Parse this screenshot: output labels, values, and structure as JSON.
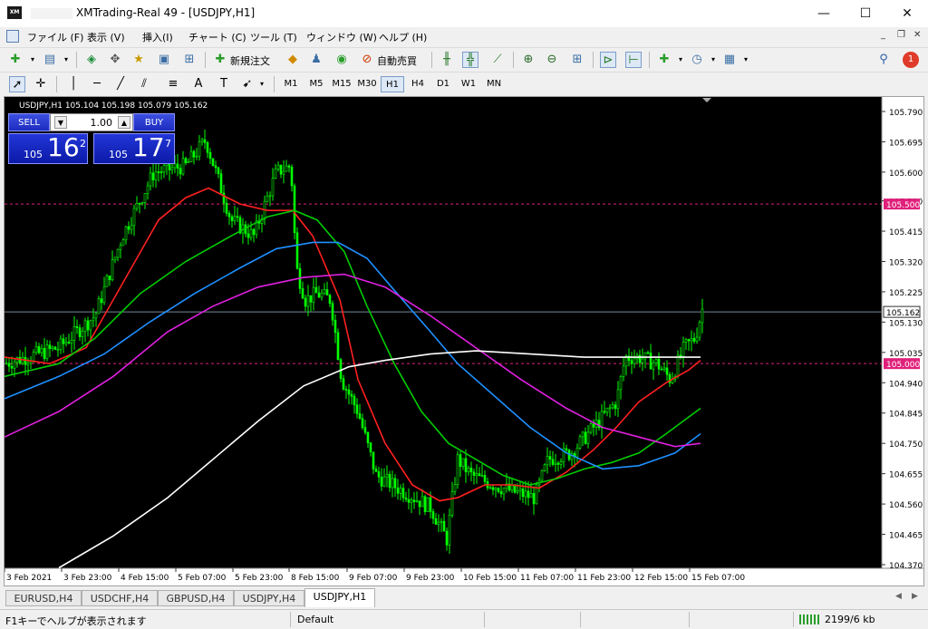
{
  "window": {
    "title": "XMTrading-Real 49 - [USDJPY,H1]",
    "logo": "XM",
    "min_icon": "—",
    "max_icon": "☐",
    "close_icon": "✕"
  },
  "menu": [
    {
      "label": "ファイル (F)"
    },
    {
      "label": "表示 (V)"
    },
    {
      "label": "挿入(I)"
    },
    {
      "label": "チャート (C)"
    },
    {
      "label": "ツール (T)"
    },
    {
      "label": "ウィンドウ (W)"
    },
    {
      "label": "ヘルプ (H)"
    }
  ],
  "toolbar": {
    "new_order_label": "新規注文",
    "auto_trade_label": "自動売買",
    "alerts_count": "1"
  },
  "timeframes": [
    "M1",
    "M5",
    "M15",
    "M30",
    "H1",
    "H4",
    "D1",
    "W1",
    "MN"
  ],
  "active_timeframe": "H1",
  "chart": {
    "header": "USDJPY,H1  105.104 105.198 105.079 105.162",
    "current_price_label": "105.162",
    "hline_upper_label": "105.500",
    "hline_lower_label": "105.000",
    "colors": {
      "background": "#000000",
      "candles": "#00ff00",
      "ma_fast": "#ff2020",
      "ma_green": "#00cc00",
      "ma_blue": "#1e90ff",
      "ma_magenta": "#e020e0",
      "ma_slow": "#ffffff",
      "hline": "#e0207a",
      "bid_line": "#778899"
    },
    "price_ticks": [
      "105.790",
      "105.695",
      "105.600",
      "105.510",
      "105.415",
      "105.320",
      "105.225",
      "105.130",
      "105.035",
      "104.940",
      "104.845",
      "104.750",
      "104.655",
      "104.560",
      "104.465",
      "104.370"
    ],
    "time_ticks": [
      "3 Feb 2021",
      "3 Feb 23:00",
      "4 Feb 15:00",
      "5 Feb 07:00",
      "5 Feb 23:00",
      "8 Feb 15:00",
      "9 Feb 07:00",
      "9 Feb 23:00",
      "10 Feb 15:00",
      "11 Feb 07:00",
      "11 Feb 23:00",
      "12 Feb 15:00",
      "15 Feb 07:00"
    ]
  },
  "trade_panel": {
    "sell_label": "SELL",
    "buy_label": "BUY",
    "lot": "1.00",
    "sell_prefix": "105",
    "sell_big": "16",
    "sell_sup": "2",
    "buy_prefix": "105",
    "buy_big": "17",
    "buy_sup": "7"
  },
  "tabs": [
    "EURUSD,H4",
    "USDCHF,H4",
    "GBPUSD,H4",
    "USDJPY,H4",
    "USDJPY,H1"
  ],
  "active_tab": "USDJPY,H1",
  "status": {
    "help_text": "F1キーでヘルプが表示されます",
    "profile": "Default",
    "traffic": "2199/6 kb"
  }
}
